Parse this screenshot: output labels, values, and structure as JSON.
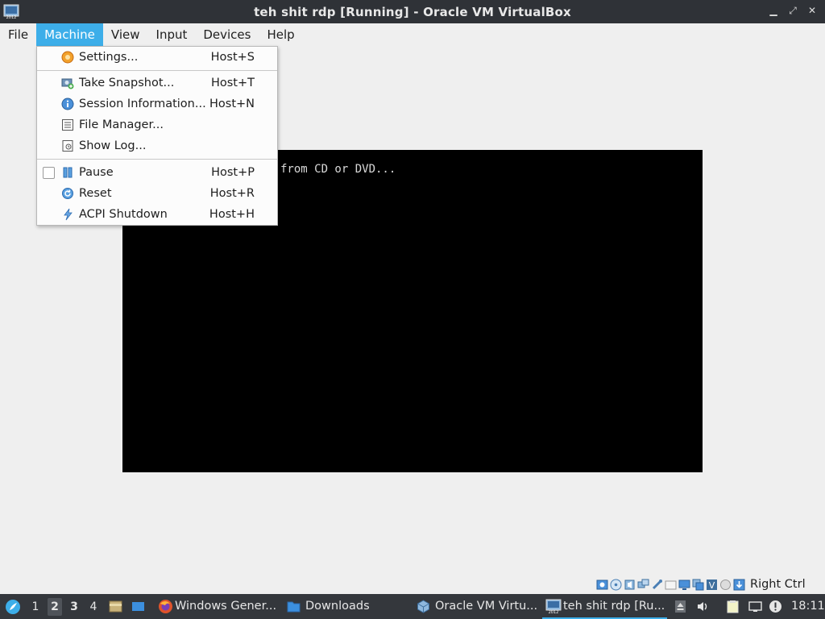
{
  "window": {
    "title": "teh shit rdp [Running] - Oracle VM VirtualBox",
    "controls": [
      "minimize",
      "maximize",
      "close"
    ]
  },
  "menubar": {
    "items": [
      {
        "label": "File"
      },
      {
        "label": "Machine",
        "active": true
      },
      {
        "label": "View"
      },
      {
        "label": "Input"
      },
      {
        "label": "Devices"
      },
      {
        "label": "Help"
      }
    ]
  },
  "machine_menu": {
    "items": [
      {
        "label": "Settings...",
        "shortcut": "Host+S",
        "icon": "settings-icon"
      },
      {
        "label": "Take Snapshot...",
        "shortcut": "Host+T",
        "icon": "snapshot-icon"
      },
      {
        "label": "Session Information...",
        "shortcut": "Host+N",
        "icon": "info-icon"
      },
      {
        "label": "File Manager...",
        "shortcut": "",
        "icon": "file-manager-icon"
      },
      {
        "label": "Show Log...",
        "shortcut": "",
        "icon": "log-icon"
      },
      {
        "label": "Pause",
        "shortcut": "Host+P",
        "icon": "pause-icon",
        "checked": false
      },
      {
        "label": "Reset",
        "shortcut": "Host+R",
        "icon": "reset-icon"
      },
      {
        "label": "ACPI Shutdown",
        "shortcut": "Host+H",
        "icon": "acpi-shutdown-icon"
      }
    ]
  },
  "vm_screen": {
    "text": "from CD or DVD..."
  },
  "statusbar": {
    "host_key": "Right Ctrl",
    "icons": [
      "hard-disk-icon",
      "optical-drive-icon",
      "audio-icon",
      "network-icon",
      "usb-icon",
      "shared-folders-icon",
      "display-icon",
      "recording-icon",
      "virtualization-icon",
      "mouse-integration-icon",
      "keyboard-icon"
    ]
  },
  "taskbar": {
    "workspaces": [
      "1",
      "2",
      "3",
      "4"
    ],
    "current_workspace": "2",
    "tasks": [
      {
        "label": "Windows Gener...",
        "icon": "firefox-icon"
      },
      {
        "label": "Downloads",
        "icon": "folder-icon"
      },
      {
        "label": "Oracle VM Virtu...",
        "icon": "virtualbox-icon"
      },
      {
        "label": "teh shit rdp [Ru...",
        "icon": "vm-window-icon",
        "active": true
      }
    ],
    "clock": "18:11"
  },
  "colors": {
    "accent": "#3daee9",
    "titlebar_bg": "#2f3237",
    "taskbar_bg": "#34373c",
    "window_bg": "#efefef"
  }
}
